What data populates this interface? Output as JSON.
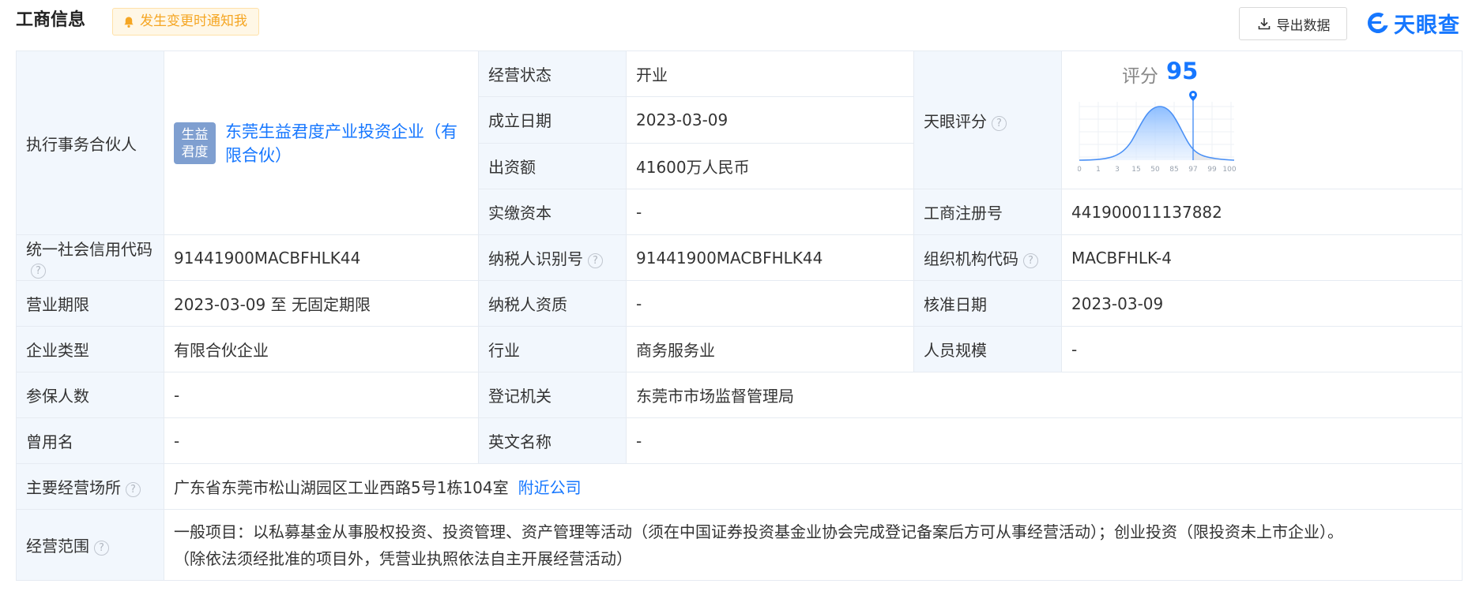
{
  "header": {
    "title": "工商信息",
    "notify_label": "发生变更时通知我",
    "export_label": "导出数据",
    "brand_name": "天眼查"
  },
  "colors": {
    "accent": "#1677ff",
    "label_bg": "#f2f7fd",
    "notify_text": "#f5a623",
    "notify_bg": "#fff7e6"
  },
  "partner": {
    "label": "执行事务合伙人",
    "avatar_line1": "生益",
    "avatar_line2": "君度",
    "name": "东莞生益君度产业投资企业（有限合伙）"
  },
  "status": {
    "label": "经营状态",
    "value": "开业"
  },
  "founded": {
    "label": "成立日期",
    "value": "2023-03-09"
  },
  "capital": {
    "label": "出资额",
    "value": "41600万人民币"
  },
  "paid_capital": {
    "label": "实缴资本",
    "value": "-"
  },
  "tianyan_score": {
    "label": "天眼评分",
    "score_label": "评分",
    "score": "95",
    "axis_ticks": [
      "0",
      "1",
      "3",
      "15",
      "50",
      "85",
      "97",
      "99",
      "100"
    ]
  },
  "reg_no": {
    "label": "工商注册号",
    "value": "441900011137882"
  },
  "credit_code": {
    "label": "统一社会信用代码",
    "value": "91441900MACBFHLK44"
  },
  "taxpayer_id": {
    "label": "纳税人识别号",
    "value": "91441900MACBFHLK44"
  },
  "org_code": {
    "label": "组织机构代码",
    "value": "MACBFHLK-4"
  },
  "term": {
    "label": "营业期限",
    "value": "2023-03-09 至 无固定期限"
  },
  "taxpayer_qual": {
    "label": "纳税人资质",
    "value": "-"
  },
  "approve_date": {
    "label": "核准日期",
    "value": "2023-03-09"
  },
  "company_type": {
    "label": "企业类型",
    "value": "有限合伙企业"
  },
  "industry": {
    "label": "行业",
    "value": "商务服务业"
  },
  "staff_size": {
    "label": "人员规模",
    "value": "-"
  },
  "insured": {
    "label": "参保人数",
    "value": "-"
  },
  "reg_authority": {
    "label": "登记机关",
    "value": "东莞市市场监督管理局"
  },
  "former_name": {
    "label": "曾用名",
    "value": "-"
  },
  "english_name": {
    "label": "英文名称",
    "value": "-"
  },
  "address": {
    "label": "主要经营场所",
    "value": "广东省东莞市松山湖园区工业西路5号1栋104室",
    "nearby_link": "附近公司"
  },
  "scope": {
    "label": "经营范围",
    "line1": "一般项目：以私募基金从事股权投资、投资管理、资产管理等活动（须在中国证券投资基金业协会完成登记备案后方可从事经营活动）；创业投资（限投资未上市企业）。",
    "line2": "（除依法须经批准的项目外，凭营业执照依法自主开展经营活动）"
  }
}
